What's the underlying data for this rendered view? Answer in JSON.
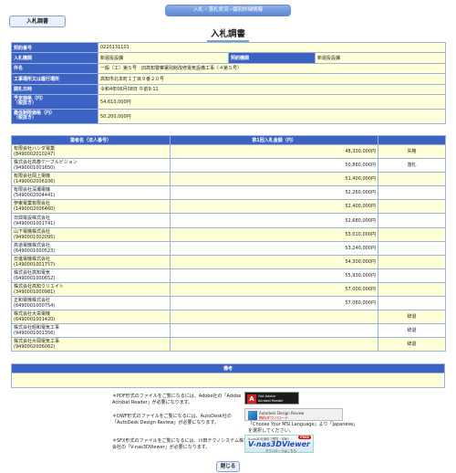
{
  "header": {
    "banner": "入札・落札状況−個別詳細情報",
    "tab_label": "入札調書",
    "title": "入札調書"
  },
  "info": {
    "contract_no_label": "契約番号",
    "contract_no": "0220131101",
    "bid_org_label": "入札機関",
    "bid_org": "新堀投設課",
    "contract_org_label": "契約機関",
    "contract_org": "新堀投設課",
    "name_label": "件名",
    "name": "一般（工）第５号　旧高知警察署別館改修電気設備工事（４第５号）",
    "place_label": "工事場所又は履行場所",
    "place": "高知市北本町１丁目９番２０号",
    "open_date_label": "開札日時",
    "open_date": "令和4年06月08日 午前9:11",
    "estimate_label": "予定価格（円）\n（税抜き）",
    "estimate": "54,610,000円",
    "min_label": "最低制限価格（円）\n（税抜き）",
    "min": "50,200,000円"
  },
  "bids": {
    "col_name": "業者名（法人番号）",
    "col_amount": "第1回入札金額（円）",
    "rows": [
      {
        "name": "有限会社ハシダ電業",
        "no": "(8490002010247)",
        "amount": "48,330,000円",
        "result": "失格"
      },
      {
        "name": "株式会社高春ケーブルビジョン",
        "no": "(9490001001650)",
        "amount": "50,860,000円",
        "result": "落札"
      },
      {
        "name": "有限会社岡上電機",
        "no": "(1490002006106)",
        "amount": "51,400,000円",
        "result": ""
      },
      {
        "name": "有限会社深瀬電機",
        "no": "(5490002004441)",
        "amount": "52,260,000円",
        "result": ""
      },
      {
        "name": "伊東電業有限会社",
        "no": "(1490002006460)",
        "amount": "52,400,000円",
        "result": ""
      },
      {
        "name": "日興電設株式会社",
        "no": "(9490001001741)",
        "amount": "52,680,000円",
        "result": ""
      },
      {
        "name": "山下電機株式会社",
        "no": "(9490001002095)",
        "amount": "53,010,000円",
        "result": ""
      },
      {
        "name": "高道電機株式会社",
        "no": "(6490001000523)",
        "amount": "53,240,000円",
        "result": ""
      },
      {
        "name": "日進電機株式会社",
        "no": "(1490001001757)",
        "amount": "54,300,000円",
        "result": ""
      },
      {
        "name": "株式会社高知電気",
        "no": "(6490001000652)",
        "amount": "55,930,000円",
        "result": ""
      },
      {
        "name": "株式会社高知クリエイト",
        "no": "(3490001000981)",
        "amount": "57,000,000円",
        "result": ""
      },
      {
        "name": "正和電機株式会社",
        "no": "(6490001000754)",
        "amount": "57,060,000円",
        "result": ""
      },
      {
        "name": "株式会社大栄電機",
        "no": "(6490001001420)",
        "amount": "",
        "result": "辞退"
      },
      {
        "name": "株式会社昭和電気工事",
        "no": "(9490001001356)",
        "amount": "",
        "result": "辞退"
      },
      {
        "name": "株式会社片岡電気工事",
        "no": "(9490002006062)",
        "amount": "",
        "result": "辞退"
      }
    ]
  },
  "remarks": {
    "header": "備考",
    "text": ""
  },
  "footer": {
    "pdf_note": "＊PDF形式のファイルをご覧になるには、Adobe社の「Adobe Acrobat Reader」が必要になります。",
    "dwf_note": "＊DWF形式のファイルをご覧になるには、AutoDesk社の「AutoDesk Design Review」が必要になります。",
    "sfx_note": "＊SFX形式のファイルをご覧になるには、川田テクノシステム株式会社の「V-nas3DViewer」が必要になります。",
    "adobe_banner_line1": "Get Adobe",
    "adobe_banner_line2": "Acrobat Reader",
    "autodesk_line1": "Autodesk Design Review",
    "autodesk_line2": "無料ダウンロード",
    "msi_note": "「Choose Your MSI Language」より「Japanese」を選択してください。",
    "vnas_small": "V-nas3Dを無料で閲覧・印刷！",
    "vnas_free": "FREE",
    "vnas_logo": "V-nas3DViewer",
    "vnas_download": "ダウンロードはこちら",
    "close_label": "閉じる"
  }
}
